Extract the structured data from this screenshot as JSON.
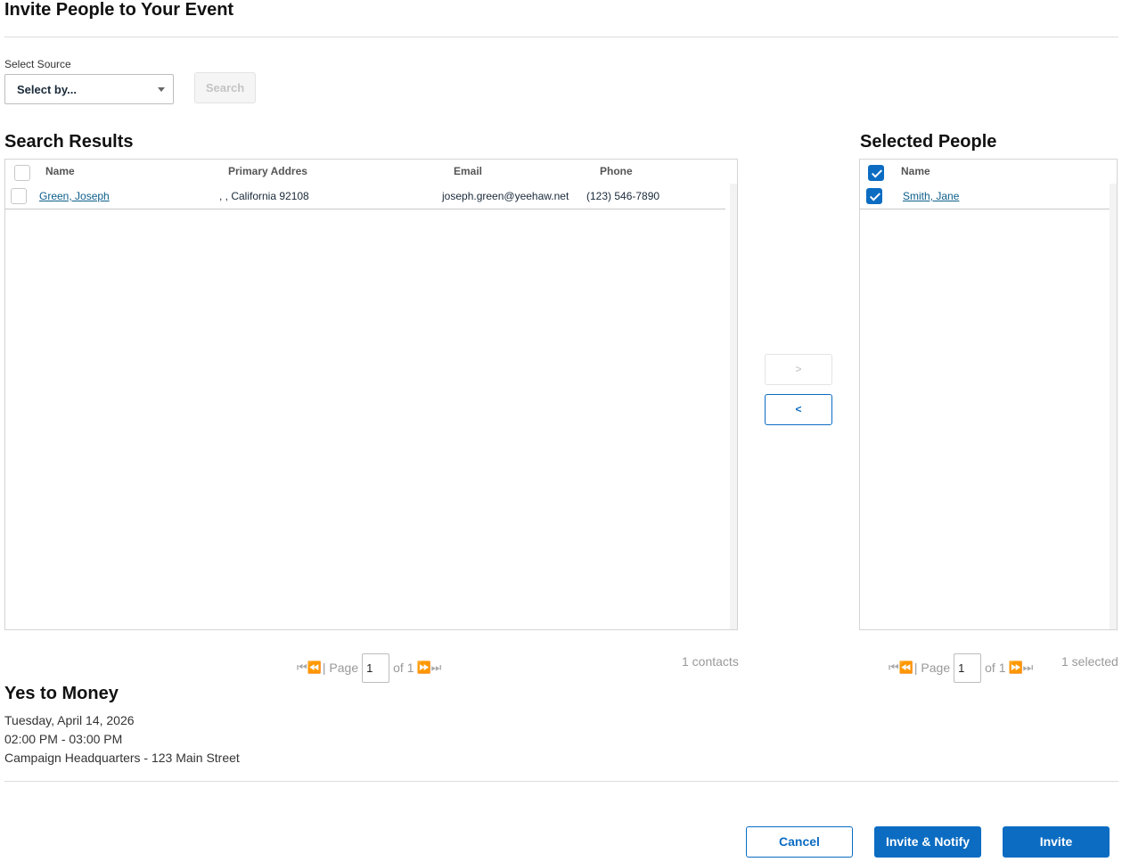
{
  "page": {
    "title": "Invite People to Your Event"
  },
  "source": {
    "label": "Select Source",
    "select_value": "Select by...",
    "search_button": "Search"
  },
  "search_results": {
    "heading": "Search Results",
    "columns": [
      "Name",
      "Primary Addres",
      "Email",
      "Phone"
    ],
    "rows": [
      {
        "name": "Green, Joseph",
        "address": ", , California 92108",
        "email": "joseph.green@yeehaw.net",
        "phone": "(123) 546-7890",
        "checked": false
      }
    ],
    "pager": {
      "page_label": "| Page",
      "page_value": "1",
      "of_label": "of 1"
    },
    "count": "1 contacts"
  },
  "move_buttons": {
    "add": ">",
    "remove": "<"
  },
  "selected_people": {
    "heading": "Selected People",
    "columns": [
      "Name"
    ],
    "header_checked": true,
    "rows": [
      {
        "name": "Smith, Jane",
        "checked": true
      }
    ],
    "pager": {
      "page_label": "| Page",
      "page_value": "1",
      "of_label": "of 1"
    },
    "count": "1 selected"
  },
  "event": {
    "name": "Yes to Money",
    "date": "Tuesday, April 14, 2026",
    "time": "02:00 PM - 03:00 PM",
    "location": "Campaign Headquarters - 123 Main Street"
  },
  "actions": {
    "cancel": "Cancel",
    "invite_notify": "Invite & Notify",
    "invite": "Invite"
  },
  "colors": {
    "accent": "#0b6cc2",
    "link": "#0b5e8a"
  },
  "icons": {
    "pager_first": "first-page-icon",
    "pager_prev": "prev-page-icon",
    "pager_next": "next-page-icon",
    "pager_last": "last-page-icon",
    "dropdown": "chevron-down-icon",
    "checkbox": "checkbox"
  }
}
